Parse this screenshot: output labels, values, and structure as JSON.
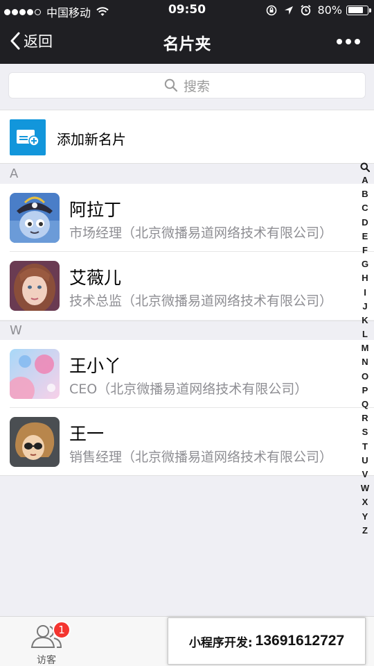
{
  "status_bar": {
    "carrier": "中国移动",
    "time": "09:50",
    "battery": "80%",
    "battery_level": 0.8
  },
  "nav": {
    "back_label": "返回",
    "title": "名片夹",
    "more_icon": "more-dots-icon"
  },
  "search": {
    "placeholder": "搜索",
    "icon": "search-icon"
  },
  "add_card": {
    "label": "添加新名片",
    "icon": "add-card-icon",
    "icon_color": "#1296db"
  },
  "sections": [
    {
      "letter": "A",
      "contacts": [
        {
          "name": "阿拉丁",
          "title": "市场经理（北京微播易道网络技术有限公司）",
          "avatar": "cartoon-pirate-avatar"
        },
        {
          "name": "艾薇儿",
          "title": "技术总监（北京微播易道网络技术有限公司）",
          "avatar": "girl-portrait-avatar"
        }
      ]
    },
    {
      "letter": "W",
      "contacts": [
        {
          "name": "王小丫",
          "title": "CEO（北京微播易道网络技术有限公司）",
          "avatar": "abstract-bubbles-avatar"
        },
        {
          "name": "王一",
          "title": "销售经理（北京微播易道网络技术有限公司）",
          "avatar": "cartoon-sunglasses-avatar"
        }
      ]
    }
  ],
  "index_bar": [
    "A",
    "B",
    "C",
    "D",
    "E",
    "F",
    "G",
    "H",
    "I",
    "J",
    "K",
    "L",
    "M",
    "N",
    "O",
    "P",
    "Q",
    "R",
    "S",
    "T",
    "U",
    "V",
    "W",
    "X",
    "Y",
    "Z"
  ],
  "tabbar": {
    "visitors_label": "访客",
    "visitors_badge": "1",
    "badge_color": "#f43530"
  },
  "promo": {
    "label": "小程序开发:",
    "phone": "13691612727"
  },
  "colors": {
    "header_bg": "#1f1f23",
    "page_bg": "#efeff4",
    "secondary_text": "#8e8e93"
  }
}
